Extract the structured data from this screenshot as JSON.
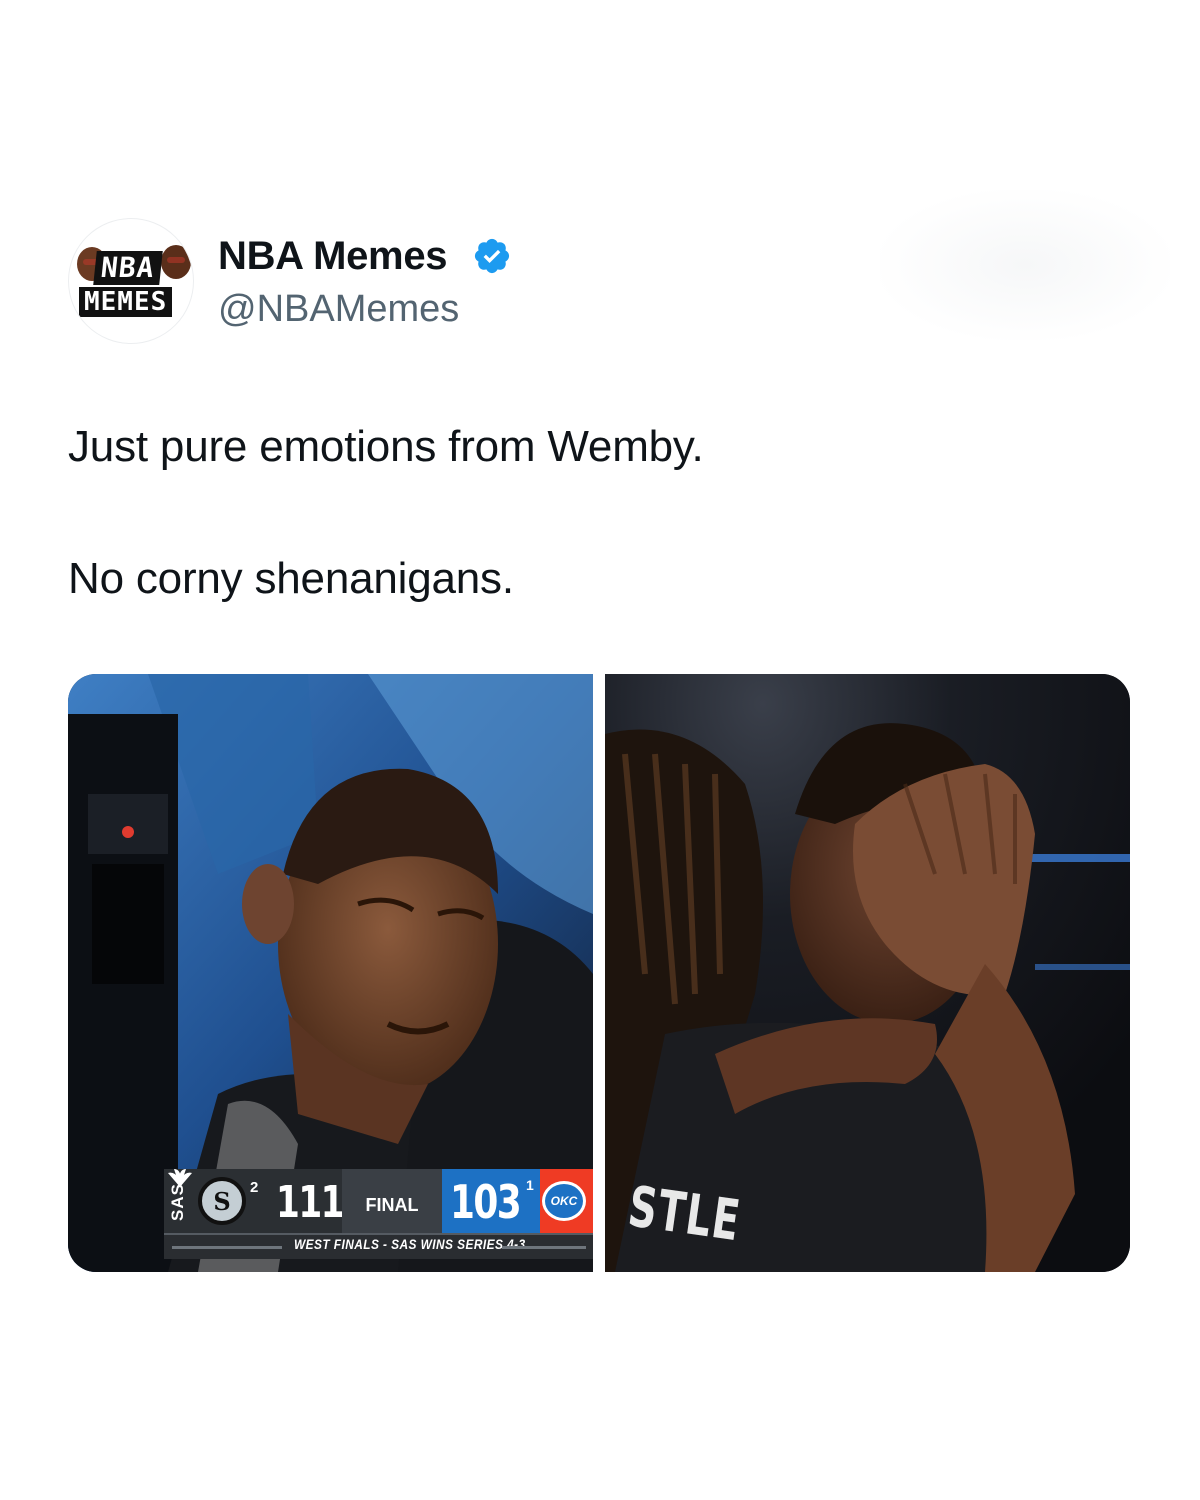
{
  "account": {
    "display_name": "NBA Memes",
    "handle": "@NBAMemes",
    "verified": true,
    "avatar_text_top": "NBA",
    "avatar_text_bottom": "MEMES",
    "verified_color": "#1d9bf0"
  },
  "tweet": {
    "line1": "Just pure emotions from Wemby.",
    "line2": "No corny shenanigans."
  },
  "media": {
    "scoreboard": {
      "team_left": "SAS",
      "series_left": "2",
      "score_left": "111",
      "status": "FINAL",
      "score_right": "103",
      "series_right": "1",
      "team_right_logo": "OKC",
      "caption": "WEST FINALS - SAS WINS SERIES 4-3",
      "colors": {
        "left": "#2b2f33",
        "right_blue": "#1d71c4",
        "right_red": "#ef3b24"
      }
    },
    "jersey_text": "STLE"
  }
}
